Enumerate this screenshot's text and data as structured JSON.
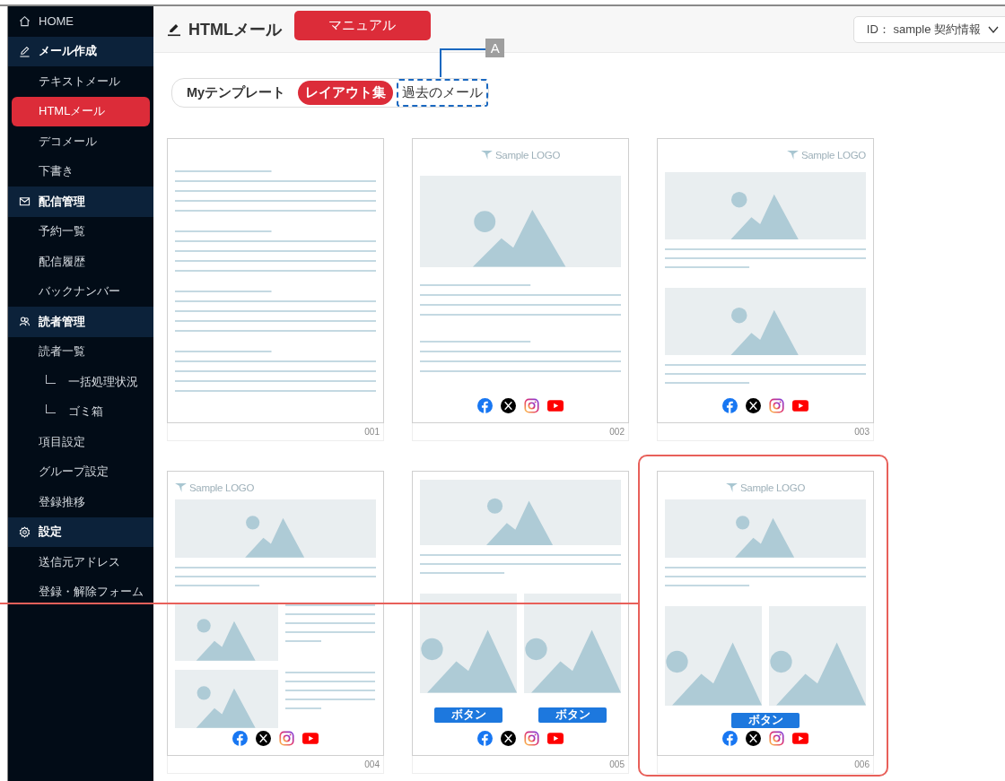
{
  "sidebar": {
    "home": {
      "label": "HOME",
      "selected": false
    },
    "sections": [
      {
        "title": "メール作成",
        "items": [
          {
            "label": "テキストメール",
            "selected": false
          },
          {
            "label": "HTMLメール",
            "selected": true
          },
          {
            "label": "デコメール",
            "selected": false
          },
          {
            "label": "下書き",
            "selected": false
          }
        ]
      },
      {
        "title": "配信管理",
        "items": [
          {
            "label": "予約一覧",
            "selected": false
          },
          {
            "label": "配信履歴",
            "selected": false
          },
          {
            "label": "バックナンバー",
            "selected": false
          }
        ]
      },
      {
        "title": "読者管理",
        "items": [
          {
            "label": "読者一覧",
            "selected": false,
            "children": [
              {
                "label": "一括処理状況",
                "selected": false
              },
              {
                "label": "ゴミ箱",
                "selected": false
              }
            ]
          },
          {
            "label": "項目設定",
            "selected": false
          },
          {
            "label": "グループ設定",
            "selected": false
          },
          {
            "label": "登録推移",
            "selected": false
          }
        ]
      },
      {
        "title": "設定",
        "items": [
          {
            "label": "送信元アドレス",
            "selected": false
          },
          {
            "label": "登録・解除フォーム",
            "selected": false
          }
        ]
      }
    ]
  },
  "header": {
    "title": "HTMLメール",
    "manual_button": "マニュアル",
    "account": "ID： sample 契約情報"
  },
  "tabs": [
    {
      "label": "Myテンプレート",
      "selected": false
    },
    {
      "label": "レイアウト集",
      "selected": true
    },
    {
      "label": "過去のメール",
      "selected": false,
      "callout": "A"
    }
  ],
  "templates": [
    {
      "number": "001",
      "kind": "text",
      "social": false,
      "highlighted": false
    },
    {
      "number": "002",
      "kind": "hero",
      "logo": {
        "text": "Sample LOGO",
        "kind": "centered"
      },
      "social": true,
      "highlighted": false
    },
    {
      "number": "003",
      "kind": "stacked",
      "logo": {
        "text": "Sample LOGO",
        "kind": "right"
      },
      "social": true,
      "highlighted": false
    },
    {
      "number": "004",
      "kind": "sidebyside",
      "logo": {
        "text": "Sample LOGO",
        "kind": "left"
      },
      "social": true,
      "highlighted": false
    },
    {
      "number": "005",
      "kind": "columns",
      "buttons": [
        "ボタン",
        "ボタン"
      ],
      "social": true,
      "highlighted": false
    },
    {
      "number": "006",
      "kind": "columns",
      "logo": {
        "text": "Sample LOGO",
        "kind": "centered"
      },
      "buttons": [
        "ボタン"
      ],
      "social": true,
      "highlighted": true
    }
  ]
}
